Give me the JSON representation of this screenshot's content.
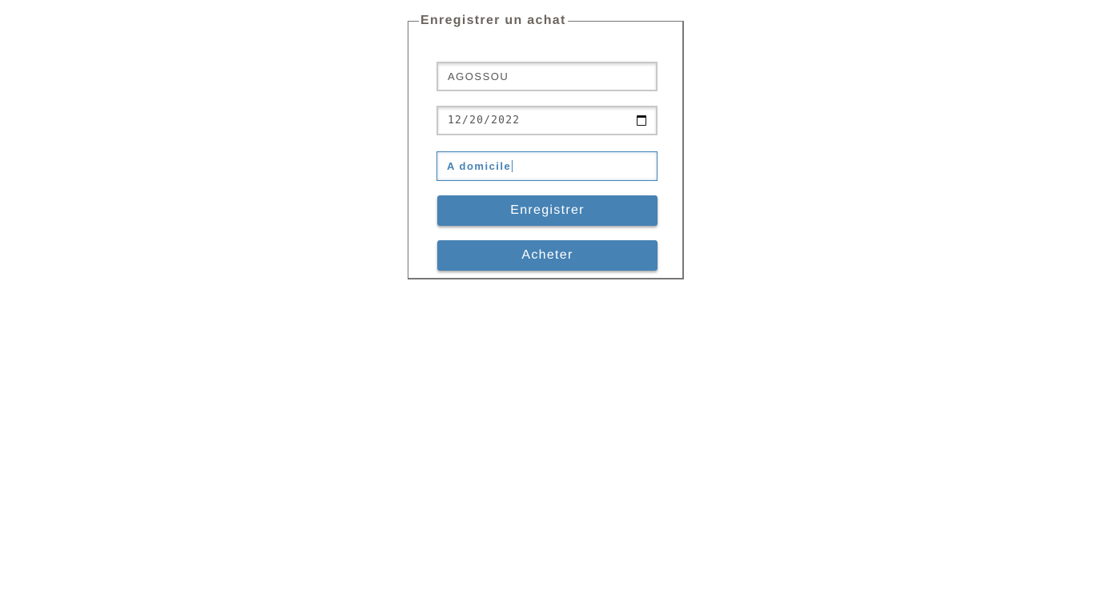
{
  "form": {
    "legend": "Enregistrer un achat",
    "name_value": "AGOSSOU",
    "date_value": "12/20/2022",
    "delivery_value": "A domicile",
    "register_label": "Enregistrer",
    "buy_label": "Acheter",
    "accent_color": "#4682b4",
    "calendar_icon": "calendar-icon"
  }
}
